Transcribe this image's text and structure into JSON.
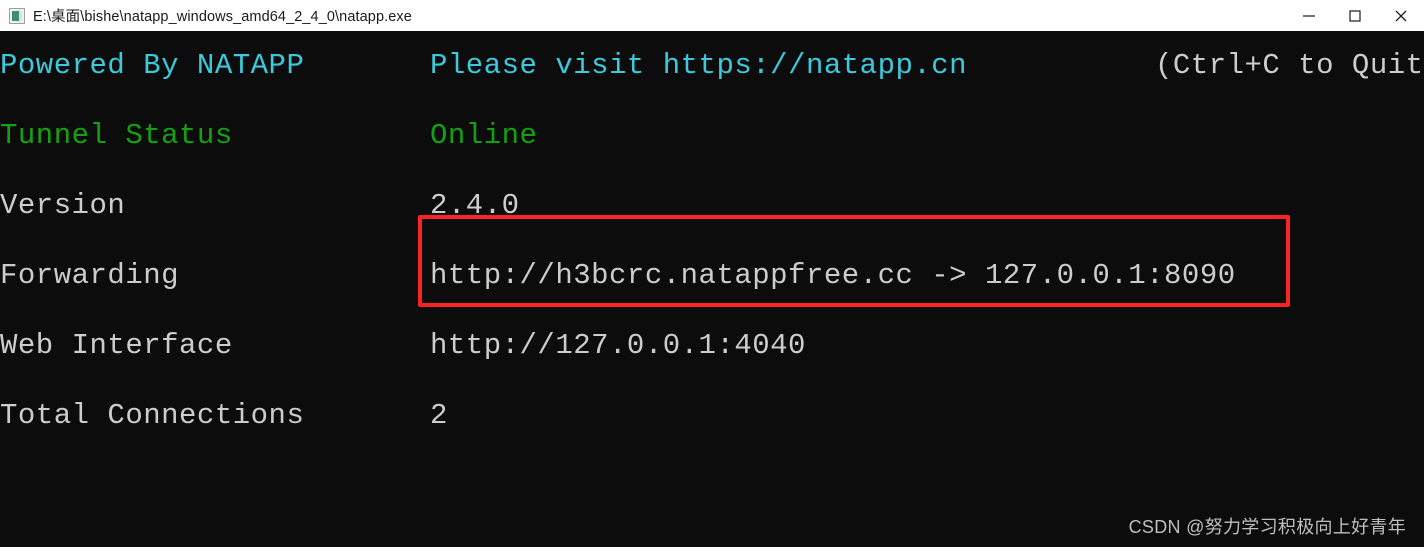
{
  "window": {
    "title": "E:\\桌面\\bishe\\natapp_windows_amd64_2_4_0\\natapp.exe",
    "icon": "console-app-icon",
    "controls": {
      "minimize": "minimize-icon",
      "maximize": "maximize-icon",
      "close": "close-icon"
    }
  },
  "colors": {
    "background": "#0c0c0c",
    "titlebar": "#ffffff",
    "cyan": "#3bc9db",
    "green": "#13a10e",
    "white": "#cccccc",
    "highlight": "#fb2222"
  },
  "console": {
    "header": {
      "powered_by": "Powered By NATAPP",
      "visit": "Please visit https://natapp.cn",
      "quit_hint": "(Ctrl+C to Quit"
    },
    "rows": [
      {
        "label": "Tunnel Status",
        "value": "Online",
        "label_color": "green",
        "value_color": "green"
      },
      {
        "label": "Version",
        "value": "2.4.0",
        "label_color": "white",
        "value_color": "white"
      },
      {
        "label": "Forwarding",
        "value": "http://h3bcrc.natappfree.cc -> 127.0.0.1:8090",
        "label_color": "white",
        "value_color": "white"
      },
      {
        "label": "Web Interface",
        "value": "http://127.0.0.1:4040",
        "label_color": "white",
        "value_color": "white"
      },
      {
        "label": "Total Connections",
        "value": "2",
        "label_color": "white",
        "value_color": "white"
      }
    ]
  },
  "watermark": {
    "text": "CSDN @努力学习积极向上好青年"
  }
}
